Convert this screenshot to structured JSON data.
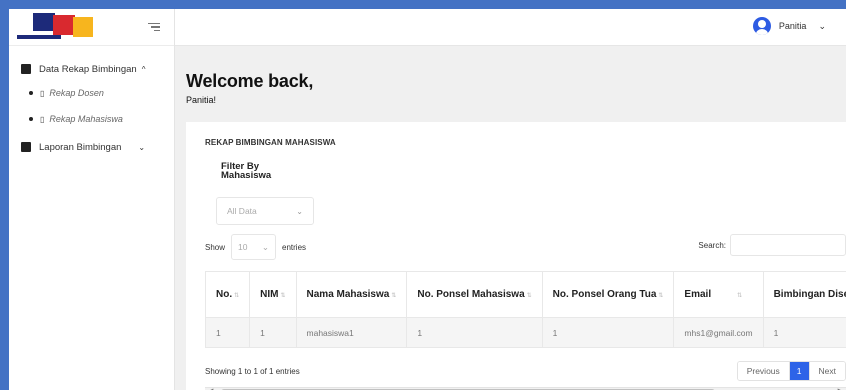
{
  "sidebar": {
    "menu": [
      {
        "label": "Data Rekap Bimbingan",
        "chevron": "^"
      },
      {
        "label": "Laporan Bimbingan",
        "chevron": "⌄"
      }
    ],
    "submenu": [
      {
        "label": "Rekap Dosen"
      },
      {
        "label": "Rekap Mahasiswa"
      }
    ]
  },
  "topbar": {
    "user_name": "Panitia",
    "user_chevron": "⌄"
  },
  "welcome": {
    "title": "Welcome back,",
    "name": "Panitia!"
  },
  "card": {
    "title": "REKAP BIMBINGAN MAHASISWA",
    "filter_label": "Filter By Mahasiswa",
    "filter_value": "All Data",
    "show_label": "Show",
    "length_value": "10",
    "entries_label": "entries",
    "search_label": "Search:",
    "search_value": "",
    "columns": [
      "No.",
      "NIM",
      "Nama Mahasiswa",
      "No. Ponsel Mahasiswa",
      "No. Ponsel Orang Tua",
      "Email",
      "Bimbingan Dise"
    ],
    "rows": [
      [
        "1",
        "1",
        "mahasiswa1",
        "1",
        "1",
        "mhs1@gmail.com",
        "1"
      ]
    ],
    "info": "Showing 1 to 1 of 1 entries",
    "pagination": {
      "previous": "Previous",
      "page": "1",
      "next": "Next"
    }
  },
  "colors": {
    "accent": "#2d63e8",
    "frame_border": "#4472c4"
  }
}
